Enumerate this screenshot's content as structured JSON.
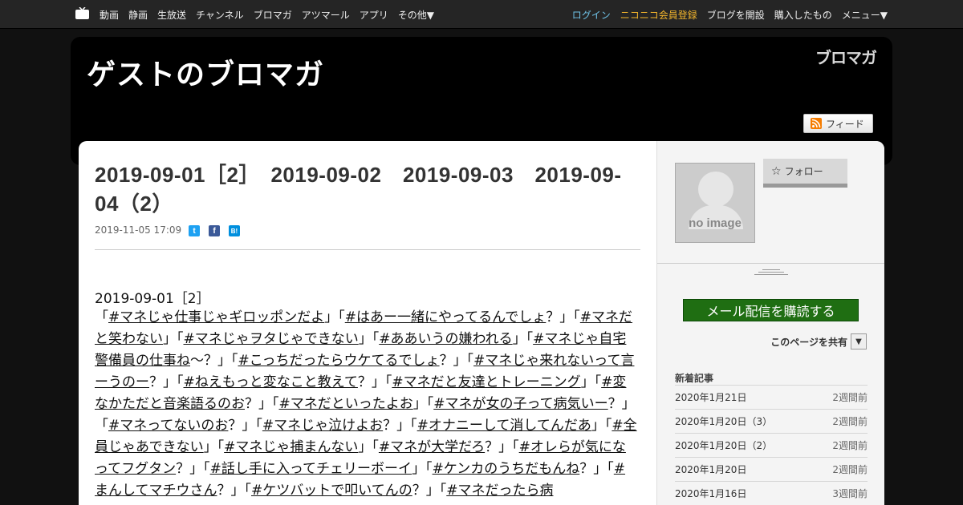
{
  "topnav": {
    "left": [
      "動画",
      "静画",
      "生放送",
      "チャンネル",
      "ブロマガ",
      "アツマール",
      "アプリ",
      "その他▼"
    ],
    "login": "ログイン",
    "register": "ニコニコ会員登録",
    "open_blog": "ブログを開設",
    "purchased": "購入したもの",
    "menu": "メニュー▼"
  },
  "header": {
    "blog_title": "ゲストのブロマガ",
    "brand_logo": "ブロマガ",
    "feed_label": "フィード"
  },
  "article": {
    "title": "2019-09-01［2］　2019-09-02　2019-09-03　2019-09-04（2）",
    "date": "2019-11-05 17:09",
    "body_heading": "2019-09-01［2］",
    "segments": [
      {
        "t": "「",
        "l": false
      },
      {
        "t": "#マネじゃ仕事じゃギロッポンだよ",
        "l": true
      },
      {
        "t": "」「",
        "l": false
      },
      {
        "t": "#はあー一緒にやってるんでしょ",
        "l": true
      },
      {
        "t": "？」「",
        "l": false
      },
      {
        "t": "#マネだと笑わない",
        "l": true
      },
      {
        "t": "」「",
        "l": false
      },
      {
        "t": "#マネじゃヲタじゃできない",
        "l": true
      },
      {
        "t": "」「",
        "l": false
      },
      {
        "t": "#ああいうの嫌われる",
        "l": true
      },
      {
        "t": "」「",
        "l": false
      },
      {
        "t": "#マネじゃ自宅警備員の仕事ね",
        "l": true
      },
      {
        "t": "〜？」「",
        "l": false
      },
      {
        "t": "#こっちだったらウケてるでしょ",
        "l": true
      },
      {
        "t": "？」「",
        "l": false
      },
      {
        "t": "#マネじゃ来れないって言ーうのー",
        "l": true
      },
      {
        "t": "？」「",
        "l": false
      },
      {
        "t": "#ねえもっと変なこと教えて",
        "l": true
      },
      {
        "t": "？」「",
        "l": false
      },
      {
        "t": "#マネだと友達とトレーニング",
        "l": true
      },
      {
        "t": "」「",
        "l": false
      },
      {
        "t": "#変なかただと音楽語るのお",
        "l": true
      },
      {
        "t": "？」「",
        "l": false
      },
      {
        "t": "#マネだといったよお",
        "l": true
      },
      {
        "t": "」「",
        "l": false
      },
      {
        "t": "#マネが女の子って病気いー",
        "l": true
      },
      {
        "t": "？」「",
        "l": false
      },
      {
        "t": "#マネってないのお",
        "l": true
      },
      {
        "t": "？」「",
        "l": false
      },
      {
        "t": "#マネじゃ泣けよお",
        "l": true
      },
      {
        "t": "？」「",
        "l": false
      },
      {
        "t": "#オナニーして消してんだあ",
        "l": true
      },
      {
        "t": "」「",
        "l": false
      },
      {
        "t": "#全員じゃあできない",
        "l": true
      },
      {
        "t": "」「",
        "l": false
      },
      {
        "t": "#マネじゃ捕まんない",
        "l": true
      },
      {
        "t": "」「",
        "l": false
      },
      {
        "t": "#マネが大学だろ",
        "l": true
      },
      {
        "t": "？」「",
        "l": false
      },
      {
        "t": "#オレらが気になってフグタン",
        "l": true
      },
      {
        "t": "？」「",
        "l": false
      },
      {
        "t": "#話し手に入ってチェリーボーイ",
        "l": true
      },
      {
        "t": "」「",
        "l": false
      },
      {
        "t": "#ケンカのうちだもんね",
        "l": true
      },
      {
        "t": "？」「",
        "l": false
      },
      {
        "t": "#まんしてマチウさん",
        "l": true
      },
      {
        "t": "？」「",
        "l": false
      },
      {
        "t": "#ケツバットで叩いてんの",
        "l": true
      },
      {
        "t": "？」「",
        "l": false
      },
      {
        "t": "#マネだったら病",
        "l": true
      }
    ]
  },
  "sidebar": {
    "no_image": "no image",
    "follow_label": "フォロー",
    "subscribe_label": "メール配信を購読する",
    "share_page_label": "このページを共有",
    "recent_heading": "新着記事",
    "recent": [
      {
        "title": "2020年1月21日",
        "ago": "2週間前"
      },
      {
        "title": "2020年1月20日（3）",
        "ago": "2週間前"
      },
      {
        "title": "2020年1月20日（2）",
        "ago": "2週間前"
      },
      {
        "title": "2020年1月20日",
        "ago": "2週間前"
      },
      {
        "title": "2020年1月16日",
        "ago": "3週間前"
      }
    ]
  },
  "colors": {
    "login": "#6fc3e8",
    "register": "#f2b52c",
    "subscribe": "#1f6e12",
    "twitter": "#1da1f2",
    "facebook": "#3b5998",
    "hatena": "#008fde"
  }
}
